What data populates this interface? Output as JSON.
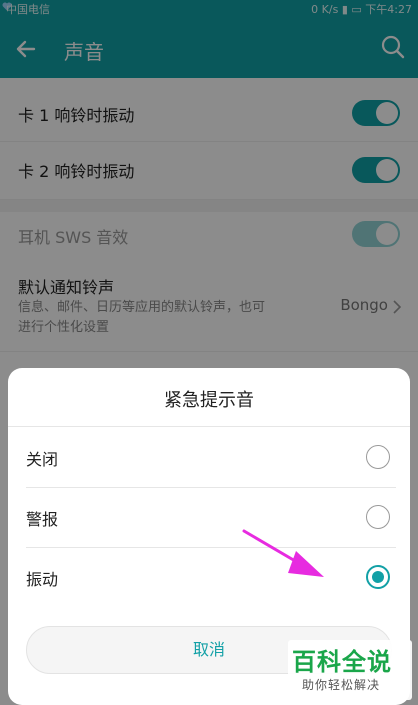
{
  "status_bar": {
    "carrier": "中国电信",
    "network": "0 K/s",
    "time": "下午4:27"
  },
  "app_bar": {
    "title": "声音"
  },
  "settings": {
    "items": [
      {
        "label": "卡 1 响铃时振动",
        "toggle_on": true
      },
      {
        "label": "卡 2 响铃时振动",
        "toggle_on": true
      },
      {
        "label": "耳机 SWS 音效",
        "toggle_on": true,
        "disabled": true
      }
    ],
    "notification": {
      "label": "默认通知铃声",
      "subtitle": "信息、邮件、日历等应用的默认铃声，也可进行个性化设置",
      "value": "Bongo"
    }
  },
  "dialog": {
    "title": "紧急提示音",
    "options": [
      {
        "label": "关闭",
        "selected": false
      },
      {
        "label": "警报",
        "selected": false
      },
      {
        "label": "振动",
        "selected": true
      }
    ],
    "cancel_label": "取消"
  },
  "watermark": {
    "brand": "百科全说",
    "tagline": "助你轻松解决"
  },
  "colors": {
    "accent": "#12a0a6",
    "arrow": "#e72be0"
  }
}
